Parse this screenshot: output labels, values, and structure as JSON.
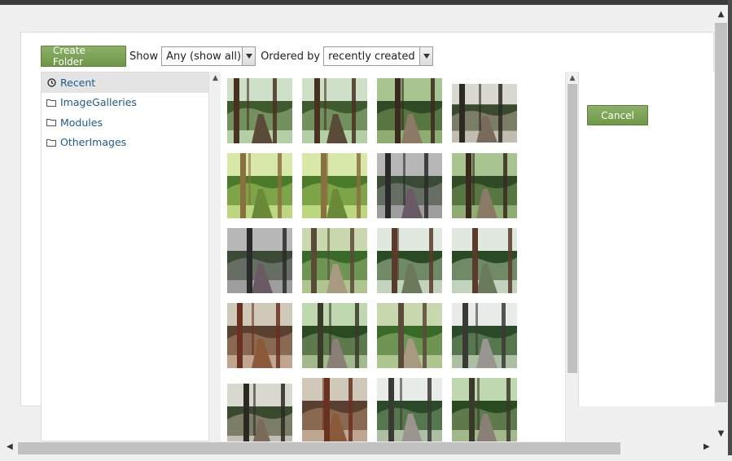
{
  "toolbar": {
    "create_folder_label": "Create Folder",
    "show_label": "Show",
    "show_value": "Any (show all)",
    "ordered_by_label": "Ordered by",
    "ordered_by_value": "recently created"
  },
  "folders": [
    {
      "label": "Recent",
      "icon": "clock-icon",
      "active": true
    },
    {
      "label": "ImageGalleries",
      "icon": "folder-icon",
      "active": false
    },
    {
      "label": "Modules",
      "icon": "folder-icon",
      "active": false
    },
    {
      "label": "OtherImages",
      "icon": "folder-icon",
      "active": false
    }
  ],
  "actions": {
    "cancel_label": "Cancel"
  },
  "colors": {
    "accent_green": "#7aa352",
    "link_blue": "#1d5a8a",
    "active_row": "#e4e4e4"
  },
  "thumbnails": [
    {
      "scene": "forest-cedar"
    },
    {
      "scene": "forest-cedar"
    },
    {
      "scene": "forest-trail"
    },
    {
      "scene": "boardwalk"
    },
    {
      "scene": "fern-forest"
    },
    {
      "scene": "fern-forest"
    },
    {
      "scene": "forest-trail-dim"
    },
    {
      "scene": "forest-trail"
    },
    {
      "scene": "forest-trail-dim"
    },
    {
      "scene": "trail-tree"
    },
    {
      "scene": "tall-trees"
    },
    {
      "scene": "tall-trees"
    },
    {
      "scene": "red-cedar"
    },
    {
      "scene": "clearing"
    },
    {
      "scene": "trail-tree"
    },
    {
      "scene": "parking-lot"
    },
    {
      "scene": "boardwalk"
    },
    {
      "scene": "red-cedar"
    },
    {
      "scene": "parking-lot"
    },
    {
      "scene": "clearing"
    }
  ]
}
